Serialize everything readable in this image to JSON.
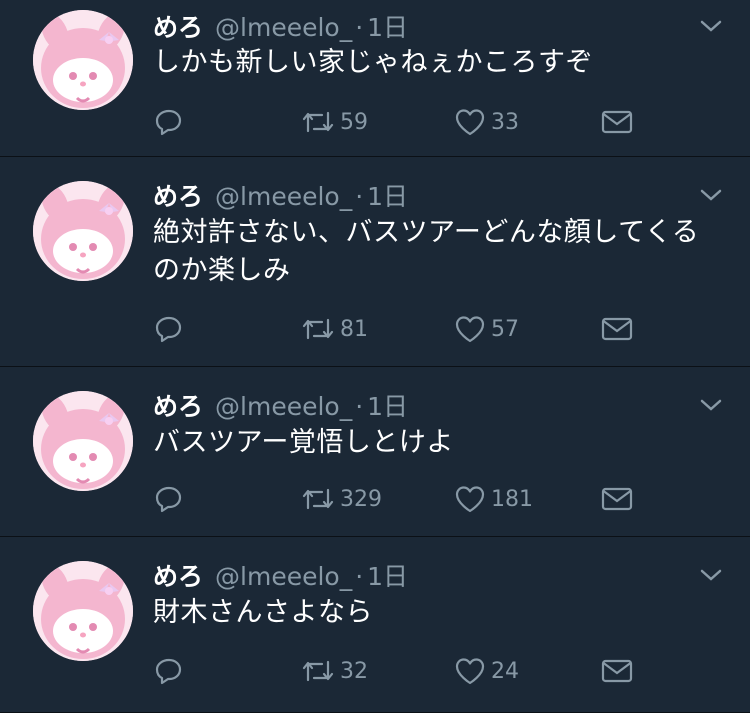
{
  "tweets": [
    {
      "display_name": "めろ",
      "handle": "@lmeeelo_",
      "separator": "·",
      "time": "1日",
      "text": "しかも新しい家じゃねぇかころすぞ",
      "retweets": "59",
      "likes": "33"
    },
    {
      "display_name": "めろ",
      "handle": "@lmeeelo_",
      "separator": "·",
      "time": "1日",
      "text": "絶対許さない、バスツアーどんな顔してくるのか楽しみ",
      "retweets": "81",
      "likes": "57"
    },
    {
      "display_name": "めろ",
      "handle": "@lmeeelo_",
      "separator": "·",
      "time": "1日",
      "text": "バスツアー覚悟しとけよ",
      "retweets": "329",
      "likes": "181"
    },
    {
      "display_name": "めろ",
      "handle": "@lmeeelo_",
      "separator": "·",
      "time": "1日",
      "text": "財木さんさよなら",
      "retweets": "32",
      "likes": "24"
    }
  ],
  "icons": {
    "reply": "reply-icon",
    "retweet": "retweet-icon",
    "like": "heart-icon",
    "dm": "direct-message-icon",
    "menu": "chevron-down-icon",
    "avatar": "my-melody-avatar"
  },
  "colors": {
    "background": "#1b2836",
    "divider": "#0b1016",
    "muted": "#8899a6",
    "text": "#ffffff",
    "avatar_pink": "#f4b6cf"
  }
}
